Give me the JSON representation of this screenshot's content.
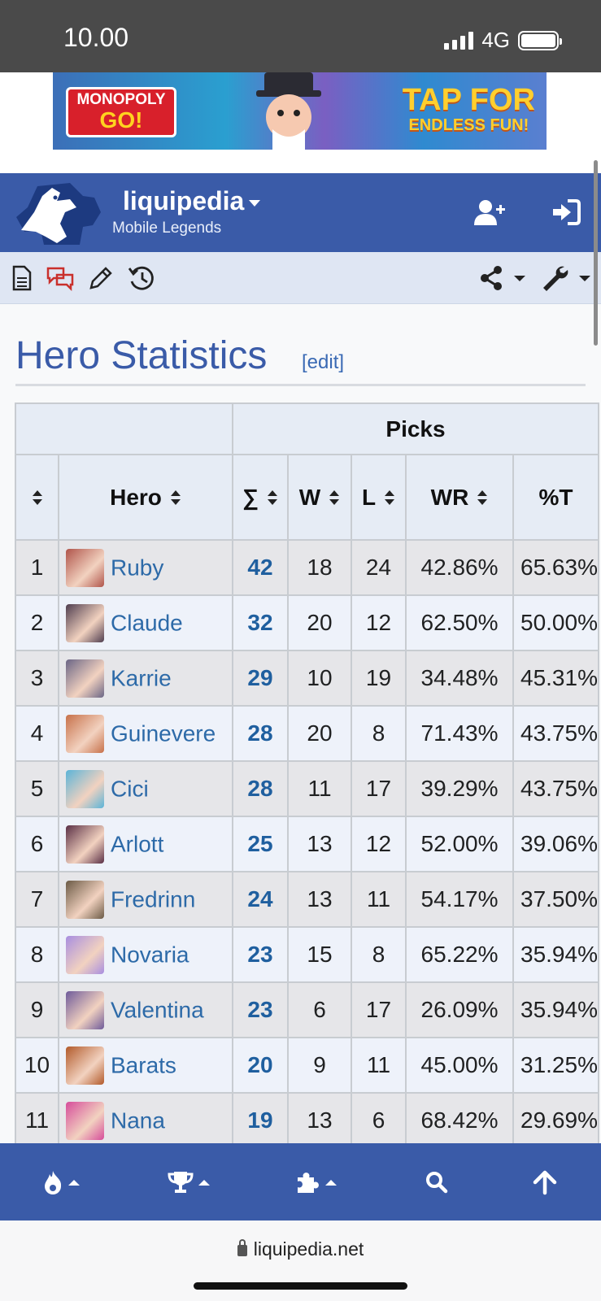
{
  "status_bar": {
    "time": "10.00",
    "network": "4G",
    "battery_level": 1.0
  },
  "ad": {
    "brand_line1": "MONOPOLY",
    "brand_line2": "GO!",
    "tagline_line1": "TAP FOR",
    "tagline_line2": "ENDLESS FUN!"
  },
  "header": {
    "site": "liquipedia",
    "wiki": "Mobile Legends",
    "icons": [
      "user-plus-icon",
      "sign-in-icon"
    ]
  },
  "toolbar": {
    "icons": [
      "page-icon",
      "discussion-icon",
      "edit-icon",
      "history-icon",
      "share-icon",
      "wrench-icon"
    ]
  },
  "page": {
    "title": "Hero Statistics",
    "edit_link": "[edit]"
  },
  "table": {
    "group_header": "Picks",
    "columns": [
      "",
      "Hero",
      "∑",
      "W",
      "L",
      "WR",
      "%T"
    ],
    "rows": [
      {
        "rank": "1",
        "hero": "Ruby",
        "total": "42",
        "w": "18",
        "l": "24",
        "wr": "42.86%",
        "pt": "65.63%",
        "color": "#b0544a"
      },
      {
        "rank": "2",
        "hero": "Claude",
        "total": "32",
        "w": "20",
        "l": "12",
        "wr": "62.50%",
        "pt": "50.00%",
        "color": "#4f3d4f"
      },
      {
        "rank": "3",
        "hero": "Karrie",
        "total": "29",
        "w": "10",
        "l": "19",
        "wr": "34.48%",
        "pt": "45.31%",
        "color": "#6a6585"
      },
      {
        "rank": "4",
        "hero": "Guinevere",
        "total": "28",
        "w": "20",
        "l": "8",
        "wr": "71.43%",
        "pt": "43.75%",
        "color": "#c7714a"
      },
      {
        "rank": "5",
        "hero": "Cici",
        "total": "28",
        "w": "11",
        "l": "17",
        "wr": "39.29%",
        "pt": "43.75%",
        "color": "#5bb4d8"
      },
      {
        "rank": "6",
        "hero": "Arlott",
        "total": "25",
        "w": "13",
        "l": "12",
        "wr": "52.00%",
        "pt": "39.06%",
        "color": "#5a2f45"
      },
      {
        "rank": "7",
        "hero": "Fredrinn",
        "total": "24",
        "w": "13",
        "l": "11",
        "wr": "54.17%",
        "pt": "37.50%",
        "color": "#6b5a45"
      },
      {
        "rank": "8",
        "hero": "Novaria",
        "total": "23",
        "w": "15",
        "l": "8",
        "wr": "65.22%",
        "pt": "35.94%",
        "color": "#a88ee0"
      },
      {
        "rank": "9",
        "hero": "Valentina",
        "total": "23",
        "w": "6",
        "l": "17",
        "wr": "26.09%",
        "pt": "35.94%",
        "color": "#6e5a9a"
      },
      {
        "rank": "10",
        "hero": "Barats",
        "total": "20",
        "w": "9",
        "l": "11",
        "wr": "45.00%",
        "pt": "31.25%",
        "color": "#b25a2a"
      },
      {
        "rank": "11",
        "hero": "Nana",
        "total": "19",
        "w": "13",
        "l": "6",
        "wr": "68.42%",
        "pt": "29.69%",
        "color": "#d64c9a"
      }
    ]
  },
  "bottom_nav": {
    "icons": [
      "fire-icon",
      "trophy-icon",
      "puzzle-icon",
      "search-icon",
      "arrow-up-icon"
    ]
  },
  "url_bar": {
    "url": "liquipedia.net"
  },
  "colors": {
    "brand": "#3a5ba8",
    "link": "#2d6aa8",
    "header_bg": "#e6ecf5"
  }
}
